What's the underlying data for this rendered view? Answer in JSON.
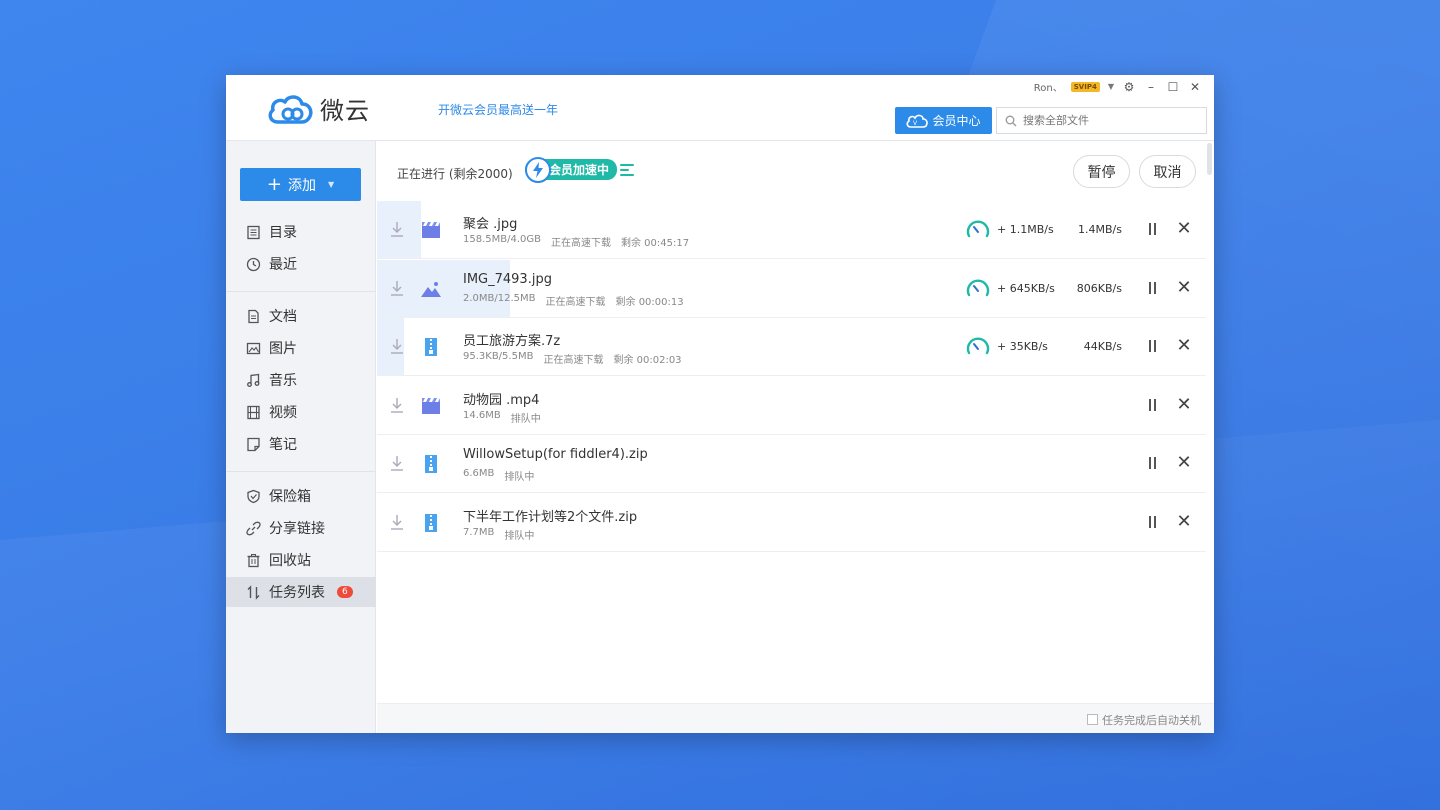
{
  "app": {
    "name": "微云",
    "promo": "开微云会员最高送一年"
  },
  "user": {
    "name": "Ron、",
    "badge": "SVIP4"
  },
  "header": {
    "vip_center": "会员中心",
    "search_placeholder": "搜索全部文件"
  },
  "sidebar": {
    "add_label": "添加",
    "items": [
      {
        "label": "目录"
      },
      {
        "label": "最近"
      },
      {
        "label": "文档"
      },
      {
        "label": "图片"
      },
      {
        "label": "音乐"
      },
      {
        "label": "视频"
      },
      {
        "label": "笔记"
      },
      {
        "label": "保险箱"
      },
      {
        "label": "分享链接"
      },
      {
        "label": "回收站"
      },
      {
        "label": "任务列表",
        "badge": "6"
      }
    ]
  },
  "toolbar": {
    "status": "正在进行 (剩余2000)",
    "accel": "会员加速中",
    "pause": "暂停",
    "cancel": "取消"
  },
  "tasks": [
    {
      "name": "聚会 .jpg",
      "size": "158.5MB/4.0GB",
      "status": "正在高速下载",
      "remaining": "剩余 00:45:17",
      "boost": "+ 1.1MB/s",
      "speed": "1.4MB/s",
      "progress": 0.04,
      "type": "video"
    },
    {
      "name": "IMG_7493.jpg",
      "size": "2.0MB/12.5MB",
      "status": "正在高速下载",
      "remaining": "剩余 00:00:13",
      "boost": "+ 645KB/s",
      "speed": "806KB/s",
      "progress": 0.16,
      "type": "image"
    },
    {
      "name": "员工旅游方案.7z",
      "size": "95.3KB/5.5MB",
      "status": "正在高速下载",
      "remaining": "剩余 00:02:03",
      "boost": "+ 35KB/s",
      "speed": "44KB/s",
      "progress": 0.017,
      "type": "zip"
    },
    {
      "name": "动物园 .mp4",
      "size": "14.6MB",
      "status": "排队中",
      "remaining": "",
      "boost": "",
      "speed": "",
      "progress": 0,
      "type": "video"
    },
    {
      "name": "WillowSetup(for fiddler4).zip",
      "size": "6.6MB",
      "status": "排队中",
      "remaining": "",
      "boost": "",
      "speed": "",
      "progress": 0,
      "type": "zip"
    },
    {
      "name": "下半年工作计划等2个文件.zip",
      "size": "7.7MB",
      "status": "排队中",
      "remaining": "",
      "boost": "",
      "speed": "",
      "progress": 0,
      "type": "zip"
    }
  ],
  "footer": {
    "auto_shutdown": "任务完成后自动关机"
  },
  "colors": {
    "accent": "#2c8be8",
    "teal": "#1fb9a8",
    "badge": "#ee4b3d"
  }
}
